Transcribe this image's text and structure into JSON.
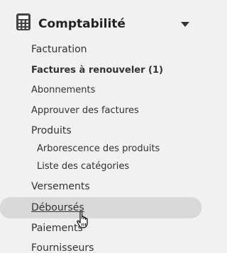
{
  "section": {
    "title": "Comptabilité",
    "icon": "calculator-icon",
    "toggle_icon": "caret-down-icon"
  },
  "items": [
    {
      "label": "Facturation",
      "level": 1,
      "bold": false
    },
    {
      "label": "Factures à renouveler (1)",
      "level": 1,
      "bold": true
    },
    {
      "label": "Abonnements",
      "level": 1,
      "bold": false
    },
    {
      "label": "Approuver des factures",
      "level": 1,
      "bold": false
    },
    {
      "label": "Produits",
      "level": 1,
      "bold": false
    },
    {
      "label": "Arborescence des produits",
      "level": 2,
      "bold": false
    },
    {
      "label": "Liste des catégories",
      "level": 2,
      "bold": false
    },
    {
      "label": "Versements",
      "level": 1,
      "bold": false
    },
    {
      "label": "Déboursés",
      "level": 1,
      "bold": false,
      "hovered": true
    },
    {
      "label": "Paiements",
      "level": 1,
      "bold": false
    },
    {
      "label": "Fournisseurs",
      "level": 1,
      "bold": false
    }
  ],
  "colors": {
    "background": "#f1f1f1",
    "hover": "#d9d9d9",
    "text": "#333333"
  },
  "cursor": "hand-pointer-icon"
}
